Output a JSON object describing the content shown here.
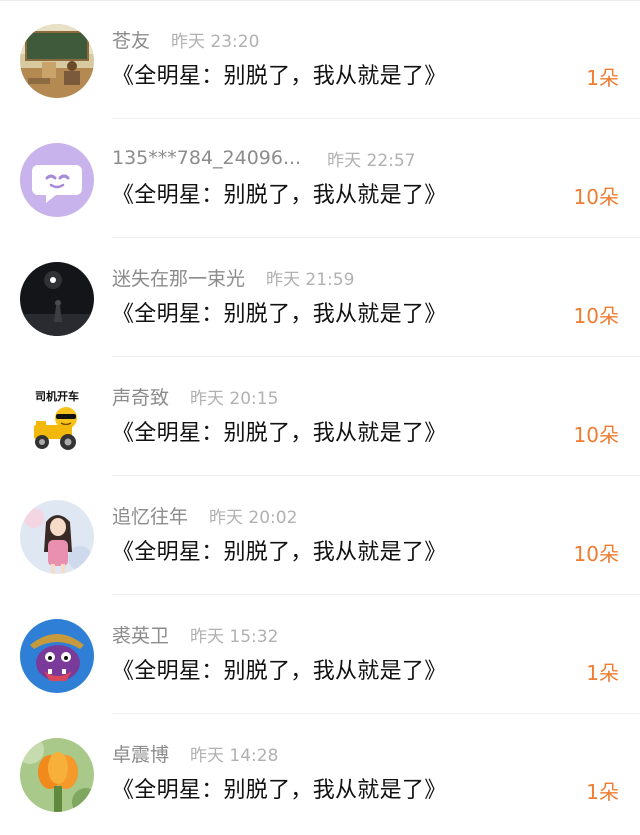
{
  "comments": [
    {
      "username": "苍友",
      "time": "昨天 23:20",
      "message": "《全明星：别脱了，我从就是了》",
      "flowers": "1朵",
      "avatar_icon": "classroom-photo-icon"
    },
    {
      "username": "135***784_24096...",
      "time": "昨天 22:57",
      "message": "《全明星：别脱了，我从就是了》",
      "flowers": "10朵",
      "avatar_icon": "chat-bubble-face-icon"
    },
    {
      "username": "迷失在那一束光",
      "time": "昨天 21:59",
      "message": "《全明星：别脱了，我从就是了》",
      "flowers": "10朵",
      "avatar_icon": "dark-night-figure-icon"
    },
    {
      "username": "声奇致",
      "time": "昨天 20:15",
      "message": "《全明星：别脱了，我从就是了》",
      "flowers": "10朵",
      "avatar_icon": "sunglasses-emoji-tractor-icon",
      "avatar_text": "司机开车"
    },
    {
      "username": "追忆往年",
      "time": "昨天 20:02",
      "message": "《全明星：别脱了，我从就是了》",
      "flowers": "10朵",
      "avatar_icon": "anime-girl-icon"
    },
    {
      "username": "裘英卫",
      "time": "昨天 15:32",
      "message": "《全明星：别脱了，我从就是了》",
      "flowers": "1朵",
      "avatar_icon": "purple-monster-icon"
    },
    {
      "username": "卓震博",
      "time": "昨天 14:28",
      "message": "《全明星：别脱了，我从就是了》",
      "flowers": "1朵",
      "avatar_icon": "orange-flower-icon"
    }
  ],
  "colors": {
    "flower_count": "#ee7d32",
    "username": "#8c8c8c",
    "time": "#b1b1b1",
    "message": "#111111"
  }
}
